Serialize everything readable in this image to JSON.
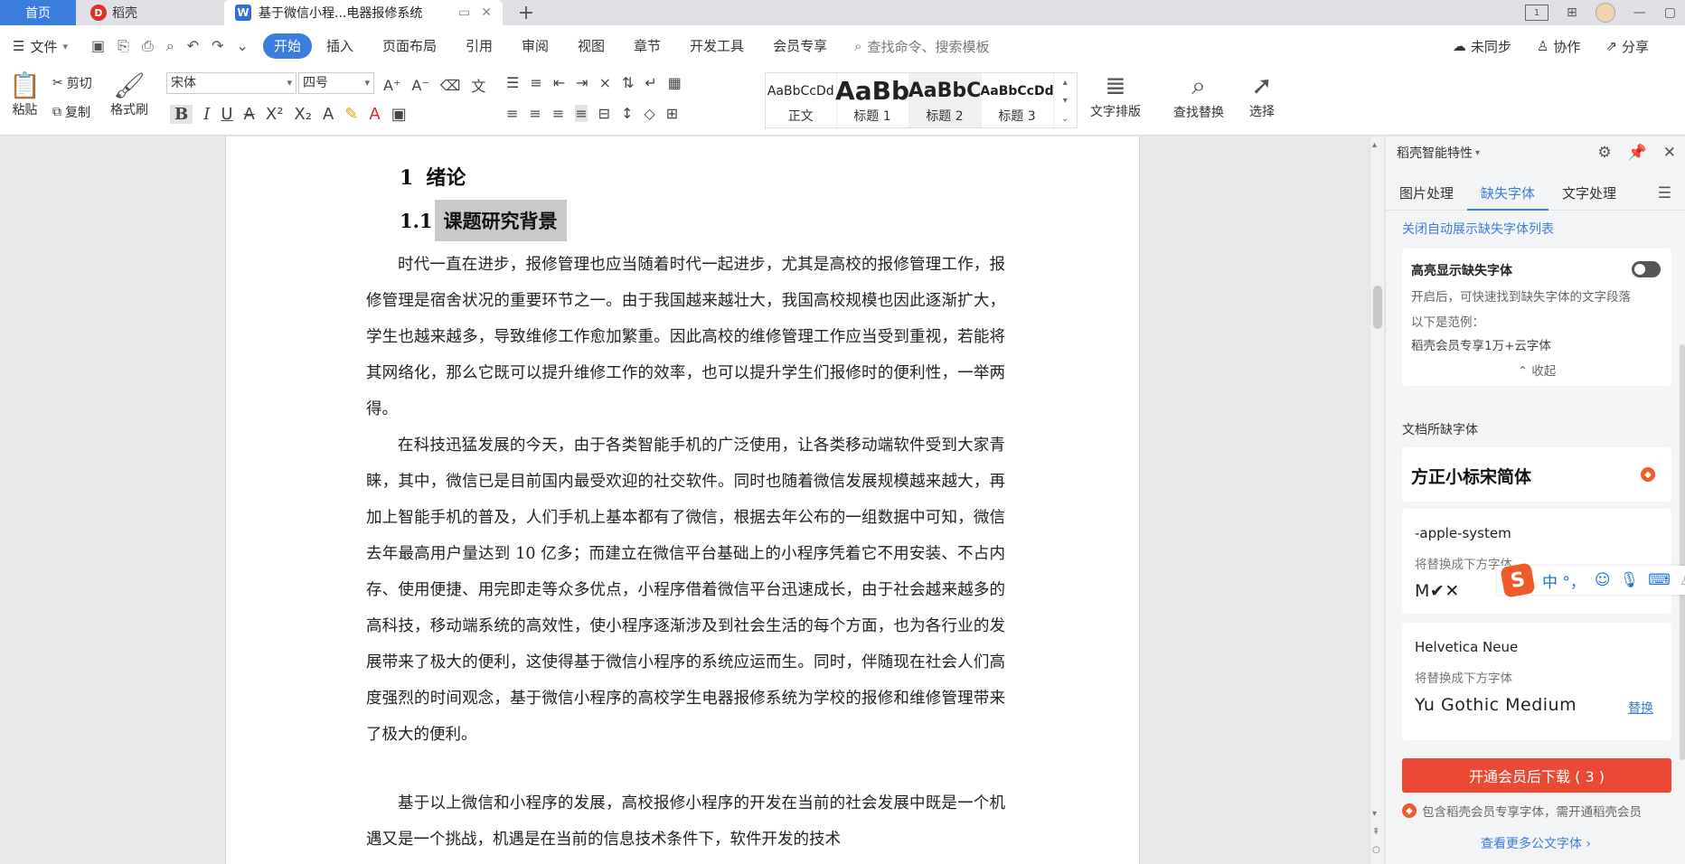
{
  "titlebar": {
    "tabs": [
      {
        "label": "首页"
      },
      {
        "label": "稻壳"
      },
      {
        "label": "基于微信小程...电器报修系统"
      }
    ]
  },
  "menubar": {
    "file_label": "文件",
    "tabs": [
      "开始",
      "插入",
      "页面布局",
      "引用",
      "审阅",
      "视图",
      "章节",
      "开发工具",
      "会员专享"
    ],
    "search_placeholder": "查找命令、搜索模板",
    "right": {
      "sync": "未同步",
      "collab": "协作",
      "share": "分享"
    }
  },
  "toolbar": {
    "paste": "粘贴",
    "cut": "剪切",
    "copy": "复制",
    "format_painter": "格式刷",
    "font_name": "宋体",
    "font_size": "四号",
    "styles": [
      {
        "preview": "AaBbCcDd",
        "label": "正文"
      },
      {
        "preview": "AaBb",
        "label": "标题 1"
      },
      {
        "preview": "AaBbC",
        "label": "标题 2"
      },
      {
        "preview": "AaBbCcDd",
        "label": "标题 3"
      }
    ],
    "text_layout": "文字排版",
    "find_replace": "查找替换",
    "select": "选择"
  },
  "document": {
    "h1_num": "1",
    "h1_text": "绪论",
    "h2_num": "1.1",
    "h2_text": "课题研究背景",
    "paragraphs": [
      "时代一直在进步，报修管理也应当随着时代一起进步，尤其是高校的报修管理工作，报修管理是宿舍状况的重要环节之一。由于我国越来越壮大，我国高校规模也因此逐渐扩大，学生也越来越多，导致维修工作愈加繁重。因此高校的维修管理工作应当受到重视，若能将其网络化，那么它既可以提升维修工作的效率，也可以提升学生们报修时的便利性，一举两得。",
      "在科技迅猛发展的今天，由于各类智能手机的广泛使用，让各类移动端软件受到大家青睐，其中，微信已是目前国内最受欢迎的社交软件。同时也随着微信发展规模越来越大，再加上智能手机的普及，人们手机上基本都有了微信，根据去年公布的一组数据中可知，微信去年最高用户量达到 10 亿多；而建立在微信平台基础上的小程序凭着它不用安装、不占内存、使用便捷、用完即走等众多优点，小程序借着微信平台迅速成长，由于社会越来越多的高科技，移动端系统的高效性，使小程序逐渐涉及到社会生活的每个方面，也为各行业的发展带来了极大的便利，这使得基于微信小程序的系统应运而生。同时，伴随现在社会人们高度强烈的时间观念，基于微信小程序的高校学生电器报修系统为学校的报修和维修管理带来了极大的便利。",
      "基于以上微信和小程序的发展，高校报修小程序的开发在当前的社会发展中既是一个机遇又是一个挑战，机遇是在当前的信息技术条件下，软件开发的技术"
    ]
  },
  "panel": {
    "title": "稻壳智能特性",
    "tabs": [
      "图片处理",
      "缺失字体",
      "文字处理"
    ],
    "close_auto_link": "关闭自动展示缺失字体列表",
    "highlight_title": "高亮显示缺失字体",
    "highlight_desc": "开启后，可快速找到缺失字体的文字段落",
    "example_label": "以下是范例：",
    "example_text": "稻壳会员专享1万+云字体",
    "collapse": "收起",
    "missing_section": "文档所缺字体",
    "font1": "方正小标宋简体",
    "font2": "-apple-system",
    "font2_sub": "将替换成下方字体",
    "font2_replace": "M✔✕",
    "font3": "Helvetica Neue",
    "font3_sub": "将替换成下方字体",
    "font3_replace": "Yu Gothic Medium",
    "replace_btn": "替换",
    "vip_button": "开通会员后下载 ( 3 )",
    "vip_note": "包含稻壳会员专享字体，需开通稻壳会员",
    "more_link": "查看更多公文字体 ›"
  },
  "ime": {
    "chars": "中 °，"
  },
  "colors": {
    "accent": "#3b7ddd",
    "vip": "#ea4a34"
  }
}
